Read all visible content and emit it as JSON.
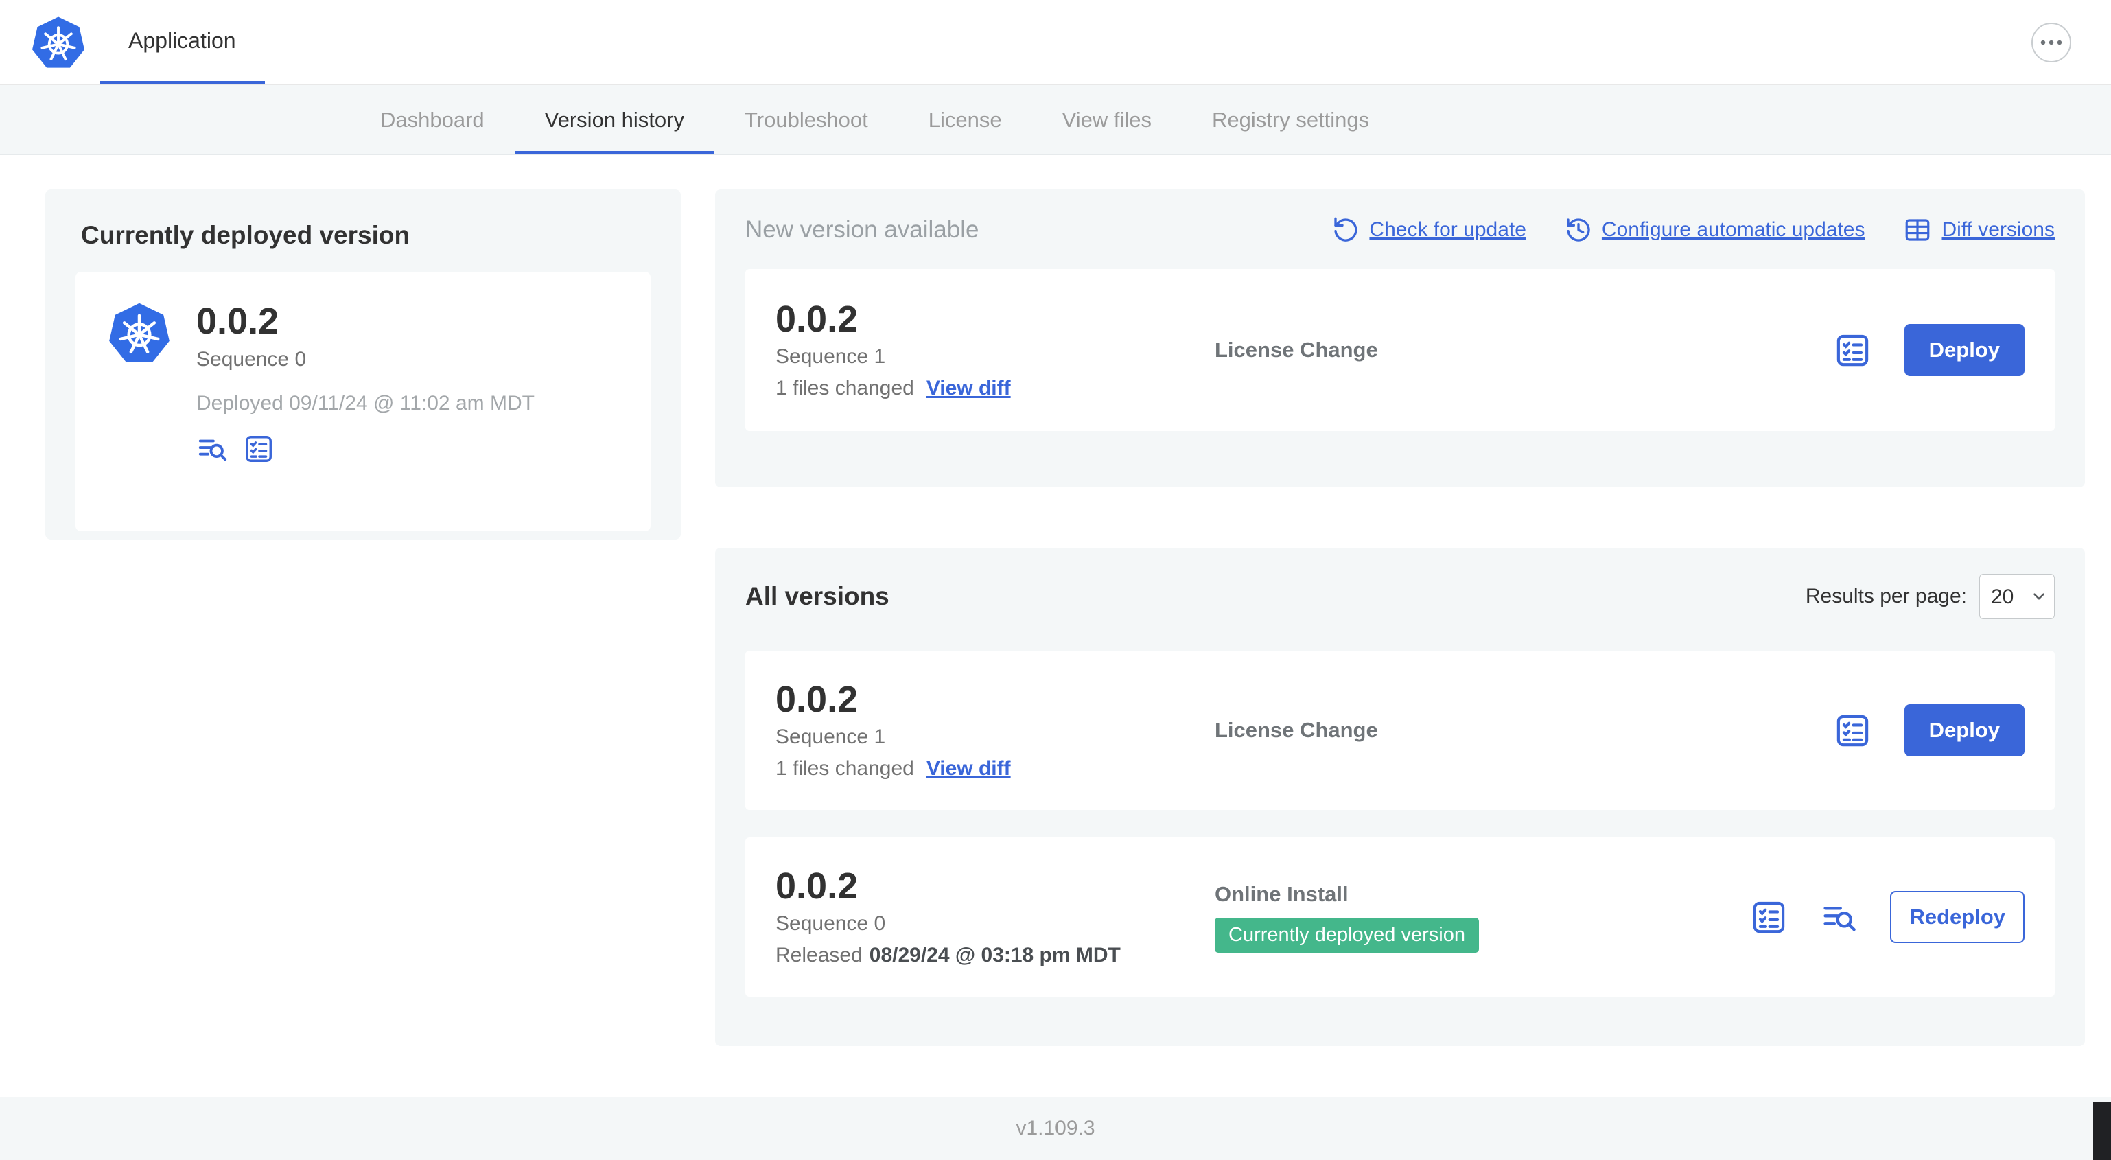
{
  "header": {
    "app_title": "Application"
  },
  "nav": {
    "tabs": [
      {
        "label": "Dashboard"
      },
      {
        "label": "Version history"
      },
      {
        "label": "Troubleshoot"
      },
      {
        "label": "License"
      },
      {
        "label": "View files"
      },
      {
        "label": "Registry settings"
      }
    ]
  },
  "current": {
    "heading": "Currently deployed version",
    "version": "0.0.2",
    "sequence": "Sequence 0",
    "deployed": "Deployed 09/11/24 @ 11:02 am MDT"
  },
  "new_version": {
    "heading": "New version available",
    "check_for_update": "Check for update",
    "configure_auto": "Configure automatic updates",
    "diff_versions": "Diff versions",
    "row": {
      "version": "0.0.2",
      "sequence": "Sequence 1",
      "files": "1 files changed",
      "view_diff": "View diff",
      "source": "License Change",
      "action": "Deploy"
    }
  },
  "all_versions": {
    "heading": "All versions",
    "results_label": "Results per page:",
    "results_value": "20",
    "rows": [
      {
        "version": "0.0.2",
        "sequence": "Sequence 1",
        "files": "1 files changed",
        "view_diff": "View diff",
        "source": "License Change",
        "action": "Deploy"
      },
      {
        "version": "0.0.2",
        "sequence": "Sequence 0",
        "released_label": "Released",
        "released_date": "08/29/24 @ 03:18 pm MDT",
        "source": "Online Install",
        "badge": "Currently deployed version",
        "action": "Redeploy"
      }
    ]
  },
  "footer": {
    "version": "v1.109.3"
  }
}
